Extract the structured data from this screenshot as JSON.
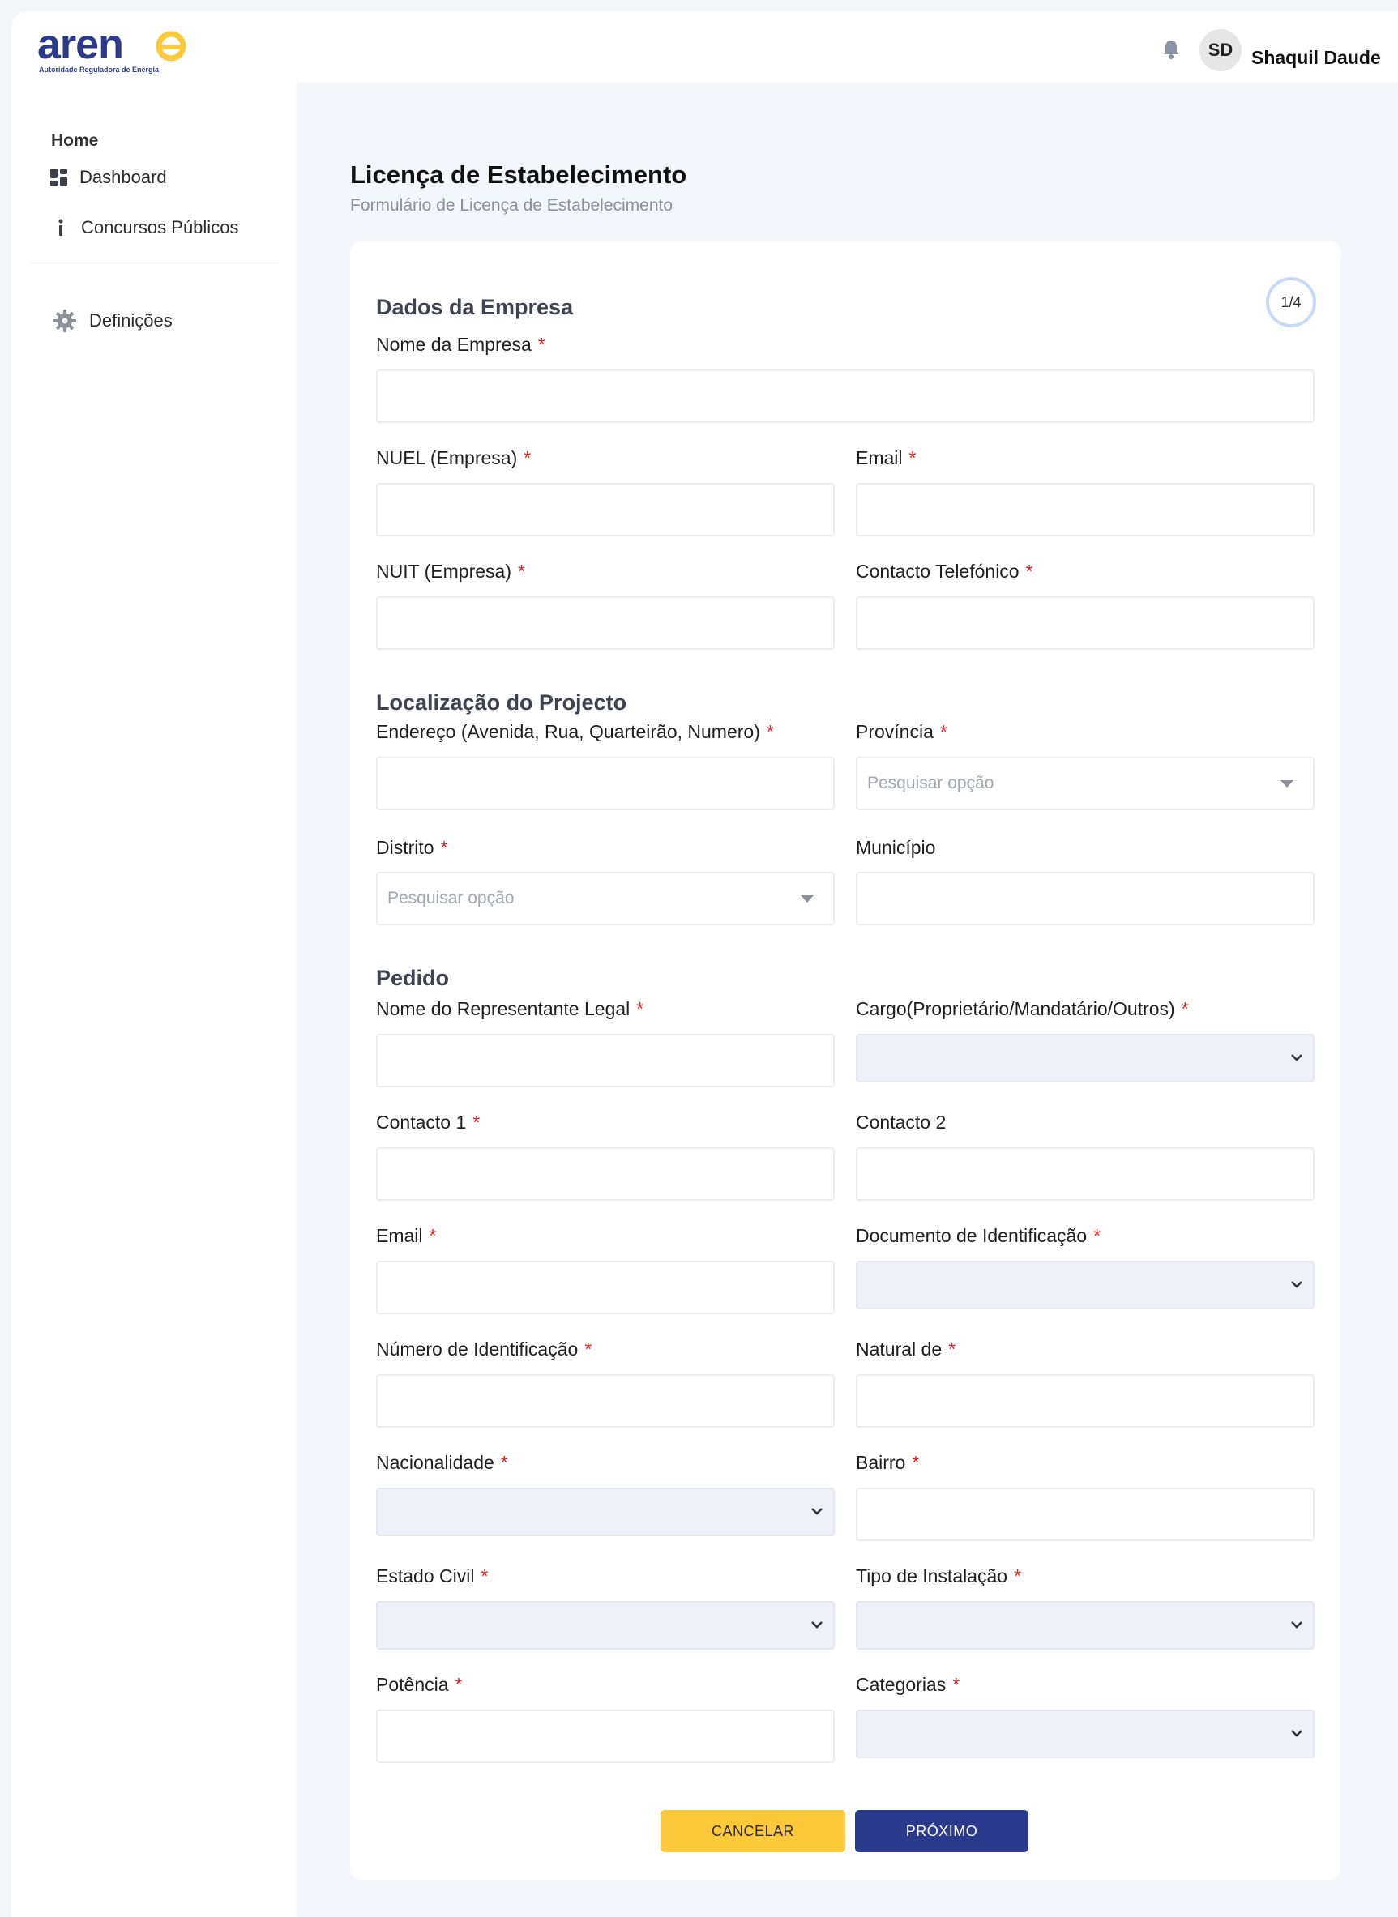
{
  "header": {
    "logo_text": "arene",
    "logo_subtitle": "Autoridade Reguladora de Energia",
    "user_initials": "SD",
    "user_name": "Shaquil Daude",
    "icons": [
      "bell-icon"
    ]
  },
  "sidebar": {
    "home_label": "Home",
    "items": [
      {
        "label": "Dashboard",
        "icon": "grid-icon"
      },
      {
        "label": "Concursos Públicos",
        "icon": "info-icon"
      },
      {
        "label": "Definições",
        "icon": "gear-icon"
      }
    ]
  },
  "page": {
    "title": "Licença de Estabelecimento",
    "subtitle": "Formulário de Licença de Estabelecimento",
    "step": "1/4"
  },
  "sections": {
    "company": "Dados da Empresa",
    "location": "Localização do Projecto",
    "request": "Pedido"
  },
  "fields": {
    "company_name": "Nome da Empresa",
    "nuel": "NUEL (Empresa)",
    "company_email": "Email",
    "nuit": "NUIT (Empresa)",
    "phone": "Contacto Telefónico",
    "address": "Endereço (Avenida, Rua, Quarteirão, Numero)",
    "province": "Província",
    "district": "Distrito",
    "municipality": "Município",
    "rep_name": "Nome do Representante Legal",
    "role": "Cargo(Proprietário/Mandatário/Outros)",
    "contact1": "Contacto 1",
    "contact2": "Contacto 2",
    "rep_email": "Email",
    "id_doc": "Documento de Identificação",
    "id_number": "Número de Identificação",
    "birthplace": "Natural de",
    "nationality": "Nacionalidade",
    "neighborhood": "Bairro",
    "marital_status": "Estado Civil",
    "install_type": "Tipo de Instalação",
    "power": "Potência",
    "categories": "Categorias"
  },
  "required_mark": "*",
  "placeholders": {
    "search_option": "Pesquisar opção"
  },
  "buttons": {
    "cancel": "CANCELAR",
    "next": "PRÓXIMO"
  },
  "colors": {
    "brand_blue": "#2b3a8c",
    "brand_yellow": "#fcc93a",
    "required_red": "#e02424"
  }
}
